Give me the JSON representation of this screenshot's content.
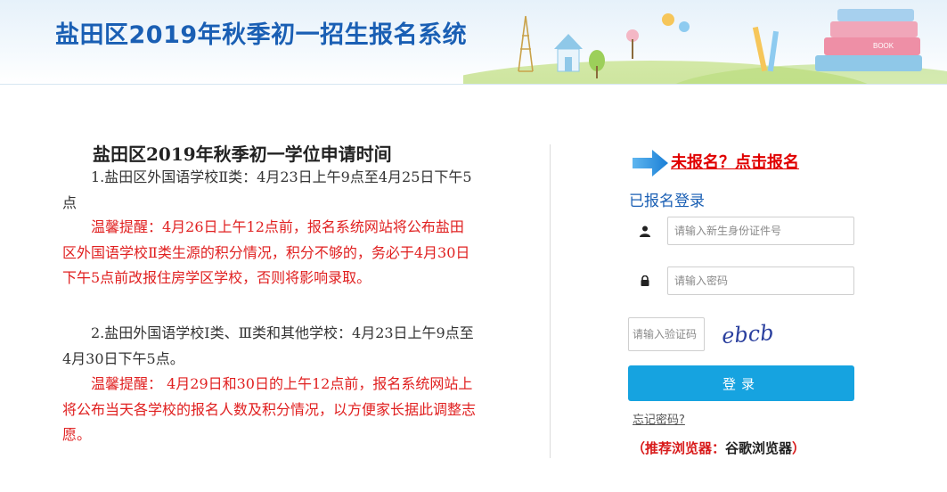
{
  "header": {
    "title": "盐田区2019年秋季初一招生报名系统",
    "banner_book_label": "BOOK"
  },
  "notice": {
    "title": "盐田区2019年秋季初一学位申请时间",
    "items": [
      {
        "text": "1.盐田区外国语学校Ⅱ类：4月23日上午9点至4月25日下午5点",
        "style": "normal"
      },
      {
        "text": "温馨提醒：4月26日上午12点前，报名系统网站将公布盐田区外国语学校Ⅱ类生源的积分情况，积分不够的，务必于4月30日下午5点前改报住房学区学校，否则将影响录取。",
        "style": "red"
      },
      {
        "text": "2.盐田外国语学校Ⅰ类、Ⅲ类和其他学校：4月23日上午9点至4月30日下午5点。",
        "style": "normal"
      },
      {
        "text": "温馨提醒： 4月29日和30日的上午12点前，报名系统网站上将公布当天各学校的报名人数及积分情况，以方便家长据此调整志愿。",
        "style": "red"
      }
    ]
  },
  "login": {
    "register_link": "未报名？点击报名",
    "heading": "已报名登录",
    "id_placeholder": "请输入新生身份证件号",
    "password_placeholder": "请输入密码",
    "captcha_placeholder": "请输入验证码",
    "captcha_text": "ebcb",
    "button_label": "登录",
    "forgot_link": "忘记密码?",
    "browser_label": "（推荐浏览器：",
    "browser_value": "谷歌浏览器",
    "browser_close": "）"
  },
  "colors": {
    "brand_blue": "#1a5fb4",
    "button_blue": "#16a3e0",
    "warning_red": "#e02020"
  }
}
